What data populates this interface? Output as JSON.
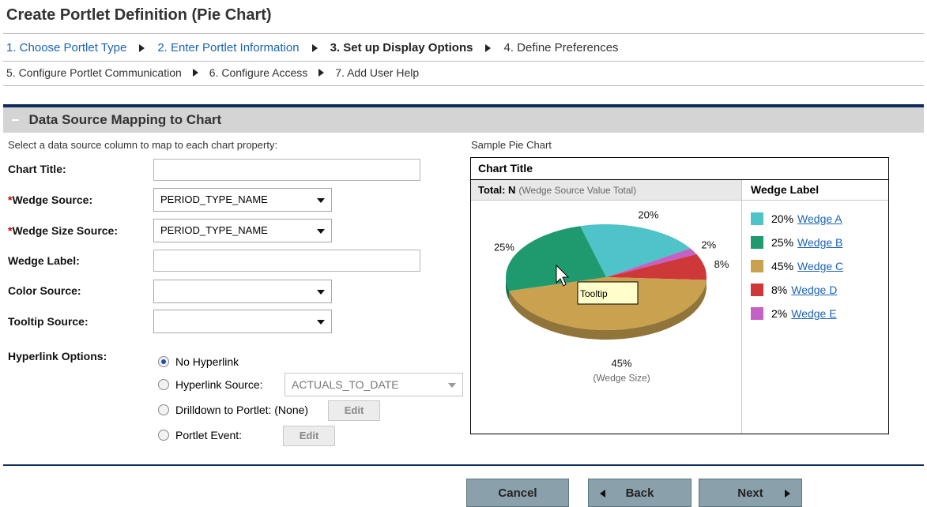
{
  "page_title": "Create Portlet Definition (Pie Chart)",
  "steps_row1": [
    {
      "label": "1. Choose Portlet Type"
    },
    {
      "label": "2. Enter Portlet Information"
    },
    {
      "label": "3. Set up Display Options"
    },
    {
      "label": "4. Define Preferences"
    }
  ],
  "steps_row2": [
    {
      "label": "5. Configure Portlet Communication"
    },
    {
      "label": "6. Configure Access"
    },
    {
      "label": "7. Add User Help"
    }
  ],
  "section": {
    "collapse_glyph": "−",
    "title": "Data Source Mapping to Chart",
    "instruction": "Select a data source column to map to each chart property:",
    "sample_label": "Sample Pie Chart"
  },
  "form": {
    "required_marker": "*",
    "chart_title_label": "Chart Title:",
    "chart_title_value": "",
    "wedge_source_label": "Wedge Source:",
    "wedge_source_value": "PERIOD_TYPE_NAME",
    "wedge_size_source_label": "Wedge Size Source:",
    "wedge_size_source_value": "PERIOD_TYPE_NAME",
    "wedge_label_label": "Wedge Label:",
    "wedge_label_value": "",
    "color_source_label": "Color Source:",
    "color_source_value": "",
    "tooltip_source_label": "Tooltip Source:",
    "tooltip_source_value": "",
    "hyperlink_options_label": "Hyperlink Options:",
    "hyperlink_options": {
      "no_hyperlink": "No Hyperlink",
      "hyperlink_source": "Hyperlink Source:",
      "hyperlink_source_value": "ACTUALS_TO_DATE",
      "drilldown": "Drilldown to Portlet: (None)",
      "portlet_event": "Portlet Event:",
      "selected": "no_hyperlink"
    },
    "edit_label": "Edit"
  },
  "sample_chart": {
    "title": "Chart Title",
    "total_label": "Total: N",
    "total_hint": "(Wedge Source Value Total)",
    "legend_header": "Wedge Label",
    "tooltip_text": "Tooltip",
    "size_caption": "(Wedge Size)",
    "wedges": [
      {
        "label": "Wedge A",
        "pct": "20%",
        "value": 20,
        "color": "#4ec3c8"
      },
      {
        "label": "Wedge B",
        "pct": "25%",
        "value": 25,
        "color": "#1f9a6e"
      },
      {
        "label": "Wedge C",
        "pct": "45%",
        "value": 45,
        "color": "#c9a14f"
      },
      {
        "label": "Wedge D",
        "pct": "8%",
        "value": 8,
        "color": "#cf3838"
      },
      {
        "label": "Wedge E",
        "pct": "2%",
        "value": 2,
        "color": "#c461c4"
      }
    ]
  },
  "buttons": {
    "cancel": "Cancel",
    "back": "Back",
    "next": "Next"
  },
  "colors": {
    "link": "#1b63b5",
    "section_bar": "#0d2d5c",
    "button_bg": "#8aa0aa"
  }
}
